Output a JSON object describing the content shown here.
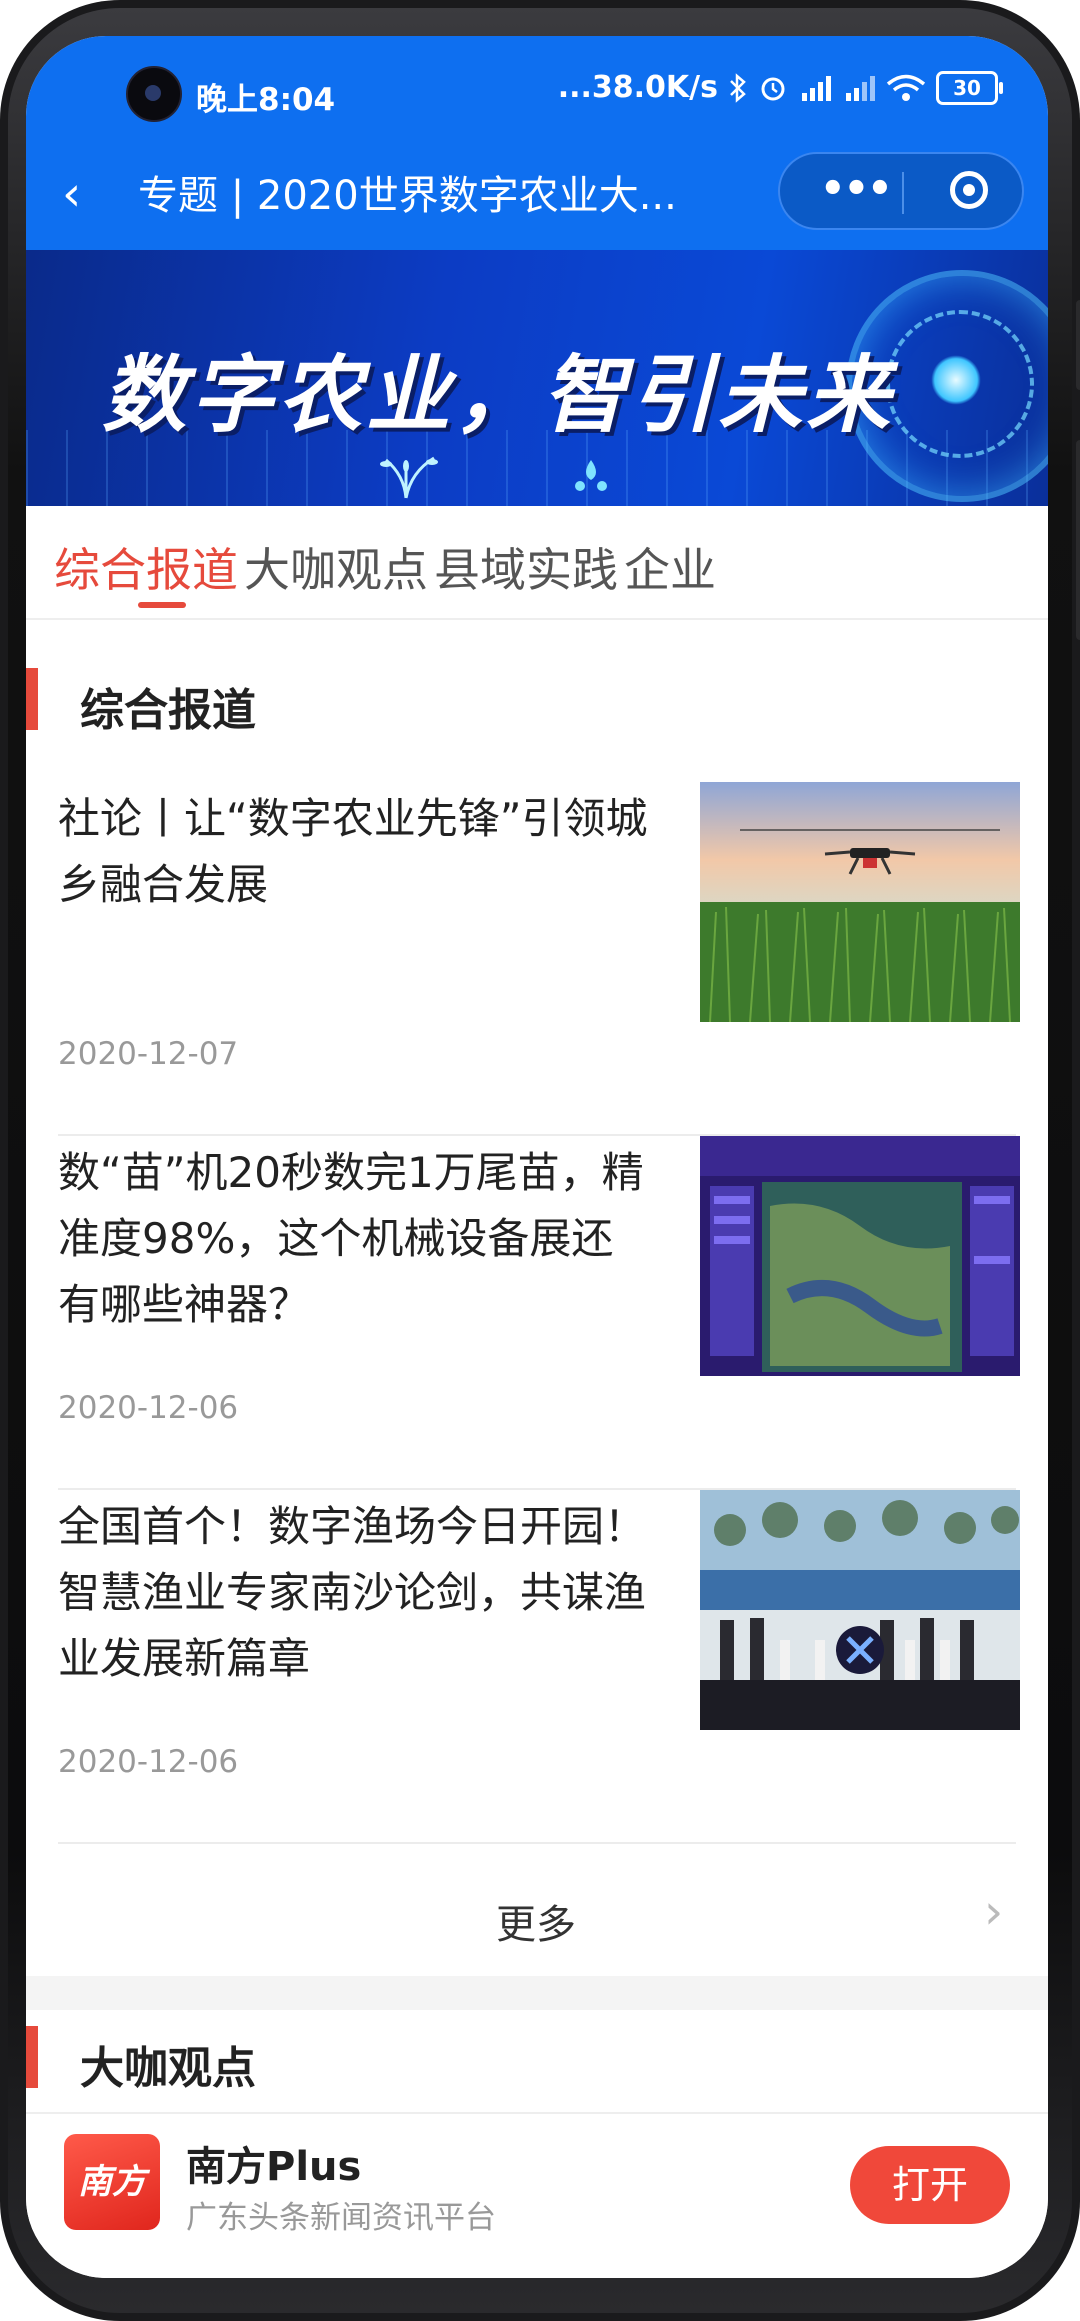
{
  "status_bar": {
    "time": "晚上8:04",
    "network_speed": "...38.0K/s",
    "battery": "30",
    "icons": [
      "bluetooth-icon",
      "alarm-icon",
      "signal-hd-icon",
      "signal-hd-icon",
      "wifi-icon",
      "battery-icon"
    ]
  },
  "nav": {
    "back_icon": "‹",
    "title": "专题 | 2020世界数字农业大...",
    "more_icon": "•••"
  },
  "banner": {
    "title": "数字农业，智引未来"
  },
  "tabs": [
    {
      "label": "综合报道",
      "active": true
    },
    {
      "label": "大咖观点",
      "active": false
    },
    {
      "label": "县域实践",
      "active": false
    },
    {
      "label": "企业",
      "active": false
    }
  ],
  "sections": [
    {
      "heading": "综合报道",
      "articles": [
        {
          "title": "社论丨让“数字农业先锋”引领城乡融合发展",
          "date": "2020-12-07",
          "image": "drone-over-field"
        },
        {
          "title": "数“苗”机20秒数完1万尾苗，精准度98%，这个机械设备展还有哪些神器？",
          "date": "2020-12-06",
          "image": "exhibition-map-screen"
        },
        {
          "title": "全国首个！数字渔场今日开园！智慧渔业专家南沙论剑，共谋渔业发展新篇章",
          "date": "2020-12-06",
          "image": "opening-ceremony-stage"
        }
      ],
      "more_label": "更多"
    },
    {
      "heading": "大咖观点"
    }
  ],
  "app_bar": {
    "logo_text": "南方+",
    "name": "南方Plus",
    "description": "广东头条新闻资讯平台",
    "open_label": "打开"
  },
  "colors": {
    "header_blue": "#0e6ff0",
    "accent_red": "#e64a3c",
    "open_button": "#f0483a"
  }
}
